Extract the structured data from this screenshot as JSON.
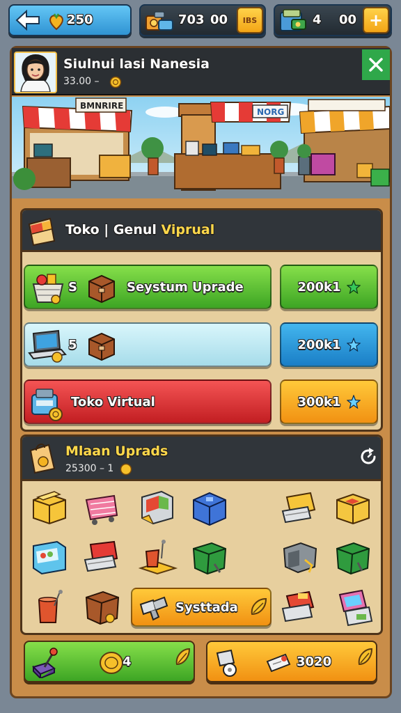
{
  "topbar": {
    "back_value": "250",
    "res1_value_a": "703",
    "res1_value_b": "00",
    "res1_badge": "IBS",
    "res2_value_a": "4",
    "res2_value_b": "00",
    "res2_plus": "+"
  },
  "store": {
    "name": "Siulnui lasi Nanesia",
    "subline": "33.00 –",
    "sign_left": "BMNRIRE",
    "sign_right": "NORG"
  },
  "toko_section": {
    "title_a": "Toko | Genul ",
    "title_b": "Viprual",
    "rows": [
      {
        "prefix": "S",
        "label": "Seystum Uprade",
        "price": "200k1"
      },
      {
        "prefix": "5",
        "label": "",
        "price": "200k1"
      },
      {
        "prefix": "",
        "label": "Toko Virtual",
        "price": "300k1"
      }
    ]
  },
  "upgrades_section": {
    "title": "Mlaan Uprads",
    "subline": "25300 – 1",
    "action_label": "Systtada"
  },
  "bottom": {
    "left_value": "4",
    "right_value": "3020"
  },
  "colors": {
    "green": "#3da524",
    "blue": "#1a7ec6",
    "red": "#c21e22",
    "orange": "#f19112",
    "panel": "#c98d49"
  },
  "icons": [
    "back-arrow-icon",
    "heart-coin-icon",
    "cash-stack-icon",
    "wallet-icon",
    "close-icon",
    "star-gem-icon",
    "refresh-icon",
    "coin-icon",
    "crate-icon"
  ]
}
